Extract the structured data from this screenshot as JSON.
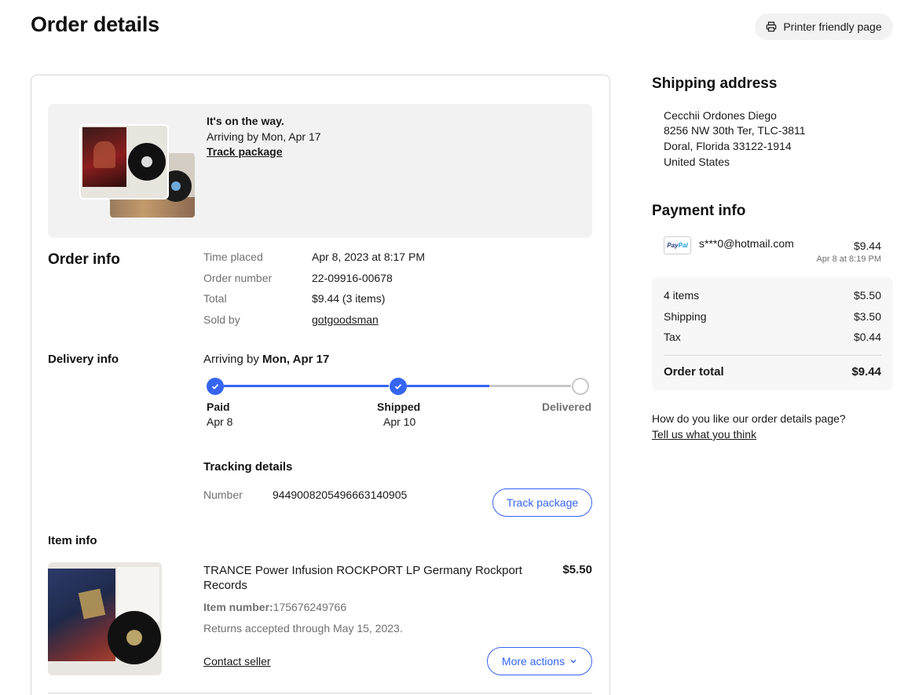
{
  "page": {
    "title": "Order details",
    "print_label": "Printer friendly page"
  },
  "status": {
    "headline": "It's on the way.",
    "eta": "Arriving by Mon, Apr 17",
    "track_link": "Track package"
  },
  "order_info": {
    "title": "Order info",
    "rows": [
      {
        "label": "Time placed",
        "value": "Apr 8, 2023 at 8:17 PM"
      },
      {
        "label": "Order number",
        "value": "22-09916-00678"
      },
      {
        "label": "Total",
        "value": "$9.44 (3 items)"
      },
      {
        "label": "Sold by",
        "value": "gotgoodsman"
      }
    ]
  },
  "delivery": {
    "title": "Delivery info",
    "arriving_prefix": "Arriving by ",
    "arriving_date": "Mon, Apr 17",
    "steps": [
      {
        "label": "Paid",
        "date": "Apr 8"
      },
      {
        "label": "Shipped",
        "date": "Apr 10"
      },
      {
        "label": "Delivered",
        "date": ""
      }
    ],
    "colors": {
      "active": "#3665f3",
      "inactive": "#c7c7c7"
    }
  },
  "tracking": {
    "title": "Tracking details",
    "number_label": "Number",
    "number": "9449008205496663140905",
    "button": "Track package"
  },
  "item": {
    "section_title": "Item info",
    "title": "TRANCE Power Infusion ROCKPORT LP Germany Rockport Records",
    "price": "$5.50",
    "number_label": "Item number:",
    "number": "175676249766",
    "returns": "Returns accepted through May 15, 2023.",
    "contact": "Contact seller",
    "more_actions": "More actions"
  },
  "shipping": {
    "title": "Shipping address",
    "lines": [
      "Cecchii Ordones Diego",
      "8256 NW 30th Ter, TLC-3811",
      "Doral, Florida 33122-1914",
      "United States"
    ]
  },
  "payment": {
    "title": "Payment info",
    "logo_part1": "Pay",
    "logo_part2": "Pal",
    "email": "s***0@hotmail.com",
    "amount": "$9.44",
    "date": "Apr 8 at 8:19 PM",
    "summary": [
      {
        "label": "4 items",
        "value": "$5.50"
      },
      {
        "label": "Shipping",
        "value": "$3.50"
      },
      {
        "label": "Tax",
        "value": "$0.44"
      }
    ],
    "total_label": "Order total",
    "total_value": "$9.44"
  },
  "feedback": {
    "question": "How do you like our order details page?",
    "link": "Tell us what you think"
  }
}
